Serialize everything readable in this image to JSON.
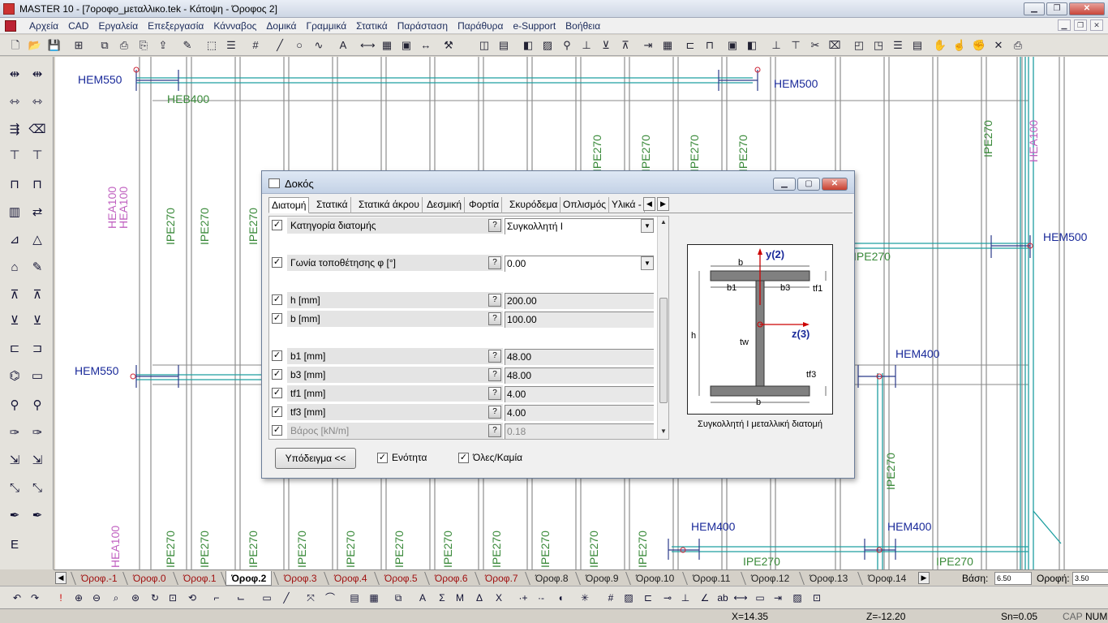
{
  "window": {
    "title": "MASTER 10 - [7οροφο_μεταλλικο.tek - Κάτοψη - Όροφος 2]"
  },
  "menu": [
    "Αρχεία",
    "CAD",
    "Εργαλεία",
    "Επεξεργασία",
    "Κάνναβος",
    "Δομικά",
    "Γραμμικά",
    "Στατικά",
    "Παράσταση",
    "Παράθυρα",
    "e-Support",
    "Βοήθεια"
  ],
  "canvas": {
    "labels": {
      "hem550_top": "HEM550",
      "heb400": "HEB400",
      "hem500_top": "HEM500",
      "hem500_right": "HEM500",
      "hem550_mid": "HEM550",
      "hem400_a": "HEM400",
      "hem400_b": "HEM400",
      "hem400_c": "HEM400",
      "ipe270": "IPE270",
      "hea100": "HEA100"
    }
  },
  "dialog": {
    "title": "Δοκός",
    "tabs": [
      "Διατομή",
      "Στατικά",
      "Στατικά άκρου",
      "Δεσμική",
      "Φορτία",
      "Σκυρόδεμα",
      "Οπλισμός",
      "Υλικά -"
    ],
    "rows": [
      {
        "label": "Κατηγορία διατομής",
        "value": "Συγκολλητή Ι",
        "checked": true,
        "dropdown": true
      },
      {
        "label": "Γωνία τοποθέτησης φ [°]",
        "value": "0.00",
        "checked": true,
        "dropdown": true
      },
      {
        "label": "h [mm]",
        "value": "200.00",
        "checked": true
      },
      {
        "label": "b [mm]",
        "value": "100.00",
        "checked": true
      },
      {
        "label": "b1 [mm]",
        "value": "48.00",
        "checked": true
      },
      {
        "label": "b3 [mm]",
        "value": "48.00",
        "checked": true
      },
      {
        "label": "tf1 [mm]",
        "value": "4.00",
        "checked": true
      },
      {
        "label": "tf3 [mm]",
        "value": "4.00",
        "checked": true
      },
      {
        "label": "Βάρος [kN/m]",
        "value": "0.18",
        "checked": true,
        "disabled": true
      }
    ],
    "help_glyph": "?",
    "example_button": "Υπόδειγμα <<",
    "unit_checkbox": "Ενότητα",
    "all_checkbox": "Όλες/Καμία",
    "preview": {
      "caption": "Συγκολλητή Ι μεταλλική διατομή",
      "y_axis": "y(2)",
      "z_axis": "z(3)",
      "b_top": "b",
      "b1": "b1",
      "b3": "b3",
      "tf1": "tf1",
      "h": "h",
      "tw": "tw",
      "tf3": "tf3",
      "b_bottom": "b"
    }
  },
  "floor_tabs": [
    "Όροφ.-1",
    "Όροφ.0",
    "Όροφ.1",
    "Όροφ.2",
    "Όροφ.3",
    "Όροφ.4",
    "Όροφ.5",
    "Όροφ.6",
    "Όροφ.7",
    "Όροφ.8",
    "Όροφ.9",
    "Όροφ.10",
    "Όροφ.11",
    "Όροφ.12",
    "Όροφ.13",
    "Όροφ.14"
  ],
  "active_floor": "Όροφ.2",
  "base": {
    "label": "Βάση:",
    "value": "6.50"
  },
  "floor_height": {
    "label": "Οροφή:",
    "value": "3.50"
  },
  "status": {
    "x": "X=14.35",
    "z": "Z=-12.20",
    "sn": "Sn=0.05",
    "caps": "CAP",
    "num": "NUM"
  },
  "colors": {
    "beam": "#1e9fa0",
    "label_green": "#3a8a3a",
    "label_blue": "#1a2a9a",
    "label_pink": "#c060c0"
  }
}
